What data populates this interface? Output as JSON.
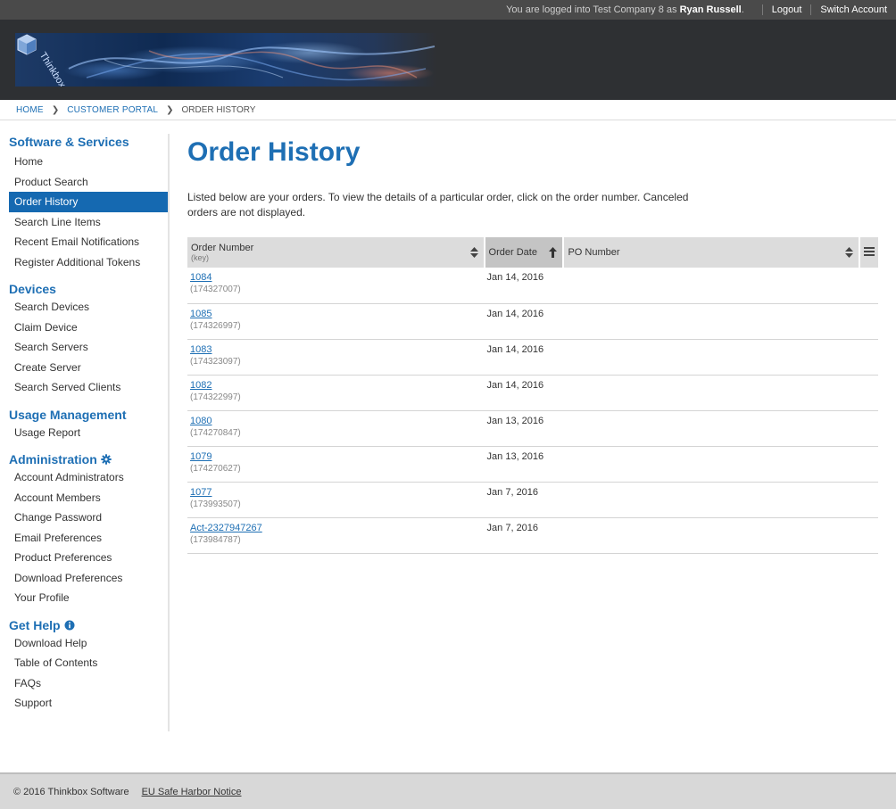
{
  "topbar": {
    "logged_in_prefix": "You are logged into Test Company 8 as",
    "user_name": "Ryan Russell",
    "logged_in_suffix": ".",
    "logout": "Logout",
    "switch_account": "Switch Account"
  },
  "header": {
    "logo_text": "Thinkbox Software"
  },
  "breadcrumb": {
    "home": "HOME",
    "portal": "CUSTOMER PORTAL",
    "current": "ORDER HISTORY"
  },
  "sidebar": {
    "groups": [
      {
        "title": "Software & Services",
        "icon": null,
        "items": [
          "Home",
          "Product Search",
          "Order History",
          "Search Line Items",
          "Recent Email Notifications",
          "Register Additional Tokens"
        ]
      },
      {
        "title": "Devices",
        "icon": null,
        "items": [
          "Search Devices",
          "Claim Device",
          "Search Servers",
          "Create Server",
          "Search Served Clients"
        ]
      },
      {
        "title": "Usage Management",
        "icon": null,
        "items": [
          "Usage Report"
        ]
      },
      {
        "title": "Administration",
        "icon": "gear-icon",
        "items": [
          "Account Administrators",
          "Account Members",
          "Change Password",
          "Email Preferences",
          "Product Preferences",
          "Download Preferences",
          "Your Profile"
        ]
      },
      {
        "title": "Get Help",
        "icon": "info-icon",
        "items": [
          "Download Help",
          "Table of Contents",
          "FAQs",
          "Support"
        ]
      }
    ],
    "active_item": "Order History"
  },
  "main": {
    "title": "Order History",
    "intro_line1": "Listed below are your orders. To view the details of a particular order, click on the order number. Canceled",
    "intro_line2": "orders are not displayed."
  },
  "table": {
    "columns": {
      "order_number": "Order Number",
      "order_number_sub": "(key)",
      "order_date": "Order Date",
      "po_number": "PO Number"
    },
    "rows": [
      {
        "number": "1084",
        "key": "(174327007)",
        "date": "Jan 14, 2016",
        "po": ""
      },
      {
        "number": "1085",
        "key": "(174326997)",
        "date": "Jan 14, 2016",
        "po": ""
      },
      {
        "number": "1083",
        "key": "(174323097)",
        "date": "Jan 14, 2016",
        "po": ""
      },
      {
        "number": "1082",
        "key": "(174322997)",
        "date": "Jan 14, 2016",
        "po": ""
      },
      {
        "number": "1080",
        "key": "(174270847)",
        "date": "Jan 13, 2016",
        "po": ""
      },
      {
        "number": "1079",
        "key": "(174270627)",
        "date": "Jan 13, 2016",
        "po": ""
      },
      {
        "number": "1077",
        "key": "(173993507)",
        "date": "Jan 7, 2016",
        "po": ""
      },
      {
        "number": "Act-2327947267",
        "key": "(173984787)",
        "date": "Jan 7, 2016",
        "po": ""
      }
    ]
  },
  "footer": {
    "copyright": "© 2016 Thinkbox Software",
    "link": "EU Safe Harbor Notice"
  },
  "colors": {
    "accent": "#1e6fb4",
    "active_bg": "#1569b1",
    "topbar_bg": "#4a4a4a",
    "header_bg": "#2e3033"
  }
}
